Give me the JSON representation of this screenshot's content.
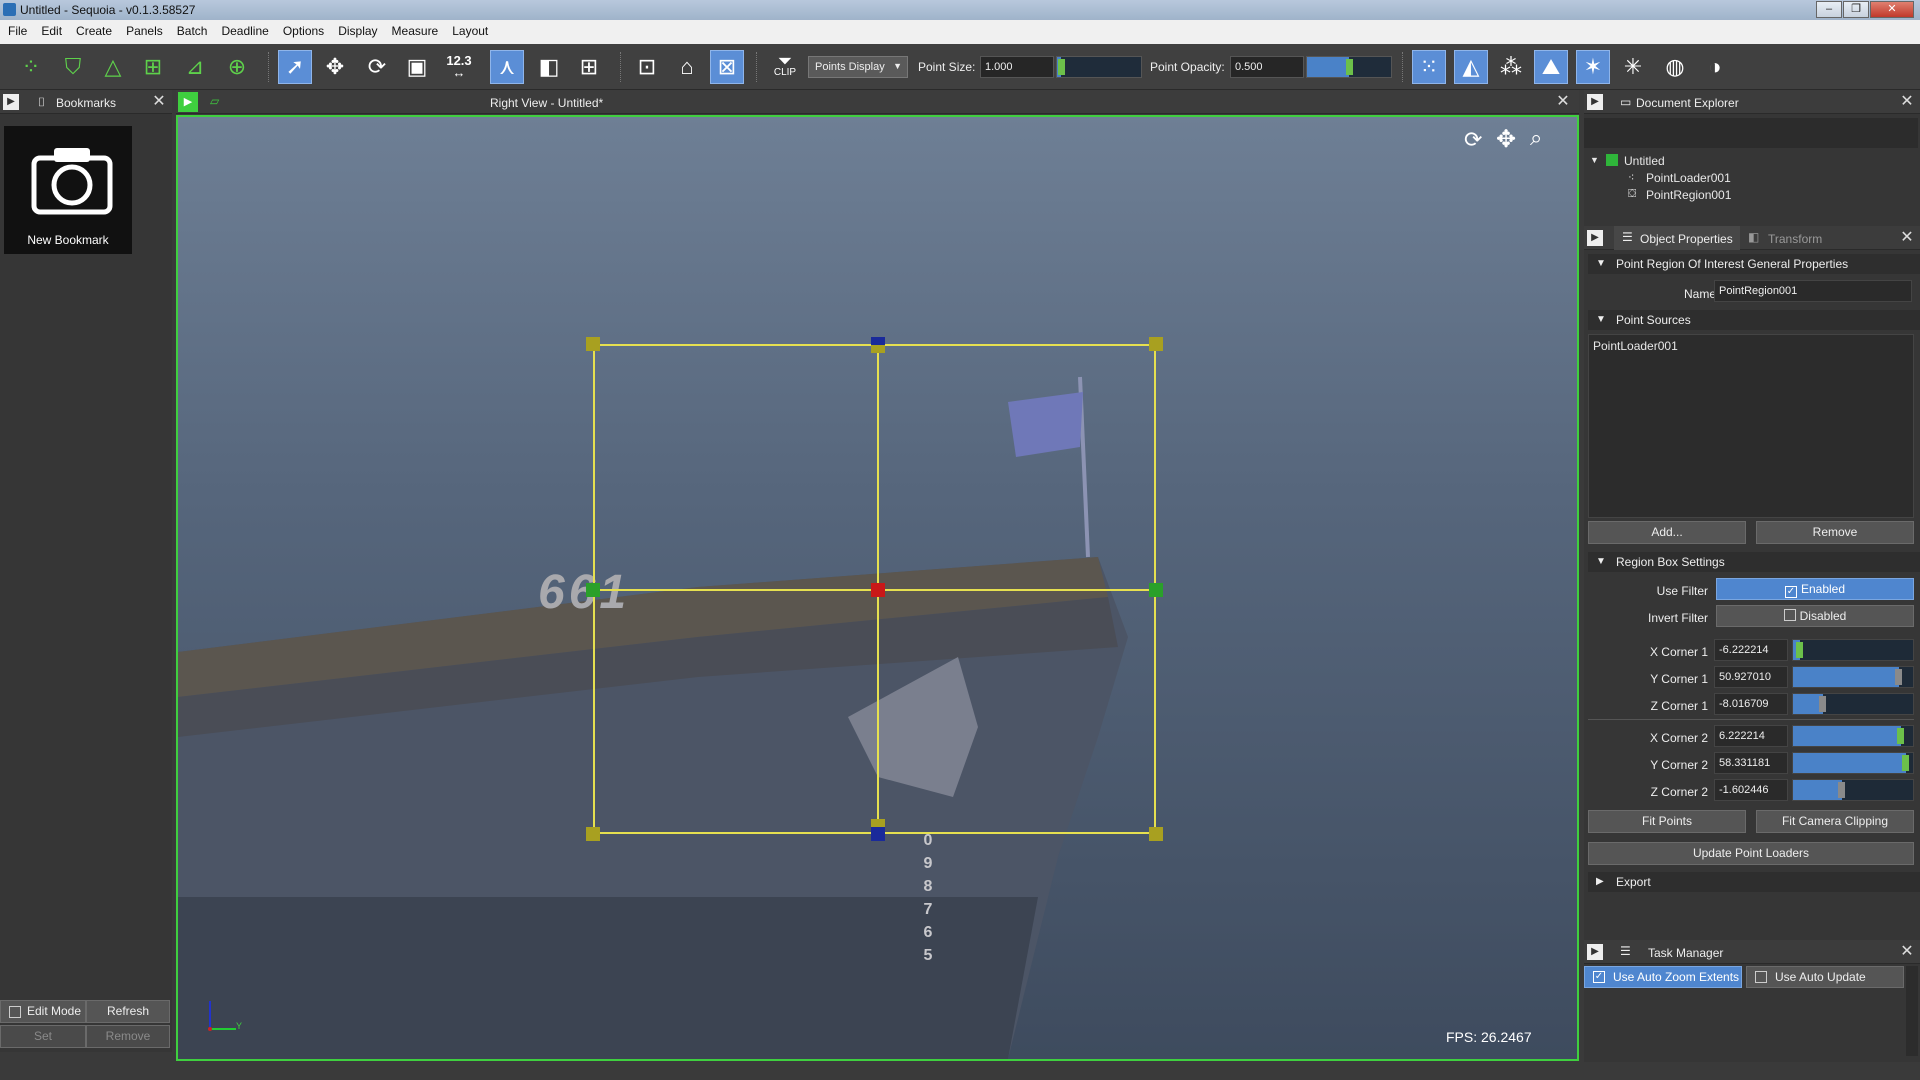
{
  "window": {
    "title": "Untitled - Sequoia - v0.1.3.58527"
  },
  "menu": [
    "File",
    "Edit",
    "Create",
    "Panels",
    "Batch",
    "Deadline",
    "Options",
    "Display",
    "Measure",
    "Layout"
  ],
  "toolbar": {
    "display_mode": "Points Display",
    "point_size_label": "Point Size:",
    "point_size_value": "1.000",
    "point_opacity_label": "Point Opacity:",
    "point_opacity_value": "0.500",
    "point_size_level": 0.05,
    "point_opacity_level": 0.5,
    "measure_label": "12.3",
    "clip_label": "CLIP"
  },
  "bookmarks": {
    "title": "Bookmarks",
    "item_label": "New Bookmark",
    "edit_mode": "Edit Mode",
    "refresh": "Refresh",
    "set": "Set",
    "remove": "Remove"
  },
  "viewport": {
    "title": "Right View - Untitled*",
    "fps_label": "FPS:",
    "fps_value": "26.2467",
    "hull_number": "661",
    "draft_marks": [
      "0",
      "9",
      "8",
      "7",
      "6",
      "5"
    ],
    "axis_label": "Y"
  },
  "document_explorer": {
    "title": "Document Explorer",
    "root": "Untitled",
    "children": [
      "PointLoader001",
      "PointRegion001"
    ]
  },
  "object_properties": {
    "tab_active": "Object Properties",
    "tab_inactive": "Transform",
    "section_general": "Point Region Of Interest General Properties",
    "name_label": "Name",
    "name_value": "PointRegion001",
    "section_sources": "Point Sources",
    "sources": [
      "PointLoader001"
    ],
    "add": "Add...",
    "remove": "Remove",
    "section_region": "Region Box Settings",
    "use_filter_label": "Use Filter",
    "use_filter_value": "Enabled",
    "invert_filter_label": "Invert Filter",
    "invert_filter_value": "Disabled",
    "corners": [
      {
        "label": "X Corner 1",
        "value": "-6.222214",
        "level": 0.06
      },
      {
        "label": "Y Corner 1",
        "value": "50.927010",
        "level": 0.88
      },
      {
        "label": "Z Corner 1",
        "value": "-8.016709",
        "level": 0.25
      },
      {
        "label": "X Corner 2",
        "value": "6.222214",
        "level": 0.9
      },
      {
        "label": "Y Corner 2",
        "value": "58.331181",
        "level": 0.94
      },
      {
        "label": "Z Corner 2",
        "value": "-1.602446",
        "level": 0.41
      }
    ],
    "fit_points": "Fit Points",
    "fit_camera_clipping": "Fit Camera Clipping",
    "update_point_loaders": "Update Point Loaders",
    "section_export": "Export"
  },
  "task_manager": {
    "title": "Task Manager",
    "auto_zoom": "Use Auto Zoom Extents",
    "auto_update": "Use Auto Update"
  },
  "colors": {
    "accent": "#4f86cf",
    "viewport_border": "#3fcf3f",
    "region_box": "#e6e050",
    "handle_olive": "#a8a020",
    "handle_red": "#c81818",
    "handle_blue": "#1a2a9a",
    "handle_green": "#2aa02a"
  }
}
